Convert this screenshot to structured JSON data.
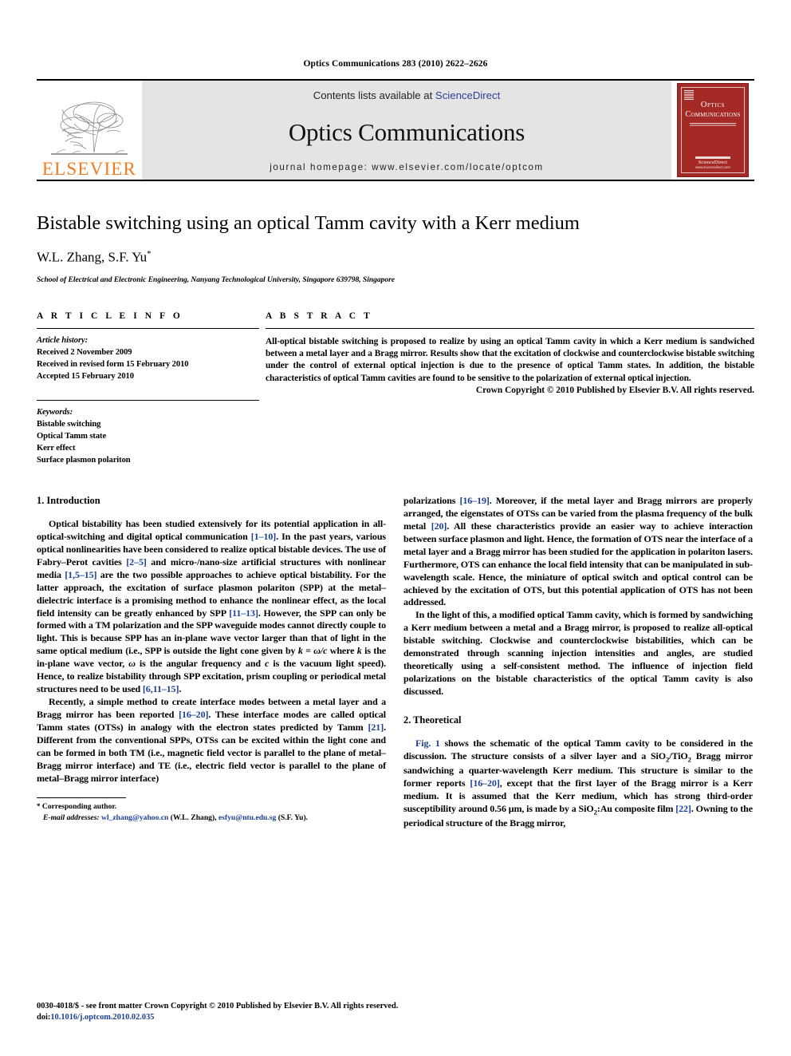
{
  "running_head": "Optics Communications 283 (2010) 2622–2626",
  "journal_header": {
    "publisher_logo_text": "ELSEVIER",
    "contents_prefix": "Contents lists available at",
    "contents_link": "ScienceDirect",
    "journal_title": "Optics Communications",
    "homepage_line": "journal homepage: www.elsevier.com/locate/optcom",
    "cover": {
      "line1": "Optics",
      "line2": "Communications",
      "footer_brand": "ScienceDirect",
      "footer_url": "www.sciencedirect.com"
    },
    "colors": {
      "banner_bg": "#e4e4e4",
      "link_blue": "#2b3f97",
      "elsevier_orange": "#ef7c20",
      "cover_red": "#a52a26"
    }
  },
  "article": {
    "title": "Bistable switching using an optical Tamm cavity with a Kerr medium",
    "authors": "W.L. Zhang, S.F. Yu",
    "corresponding_marker": "*",
    "affiliation": "School of Electrical and Electronic Engineering, Nanyang Technological University, Singapore 639798, Singapore"
  },
  "article_info": {
    "heading": "A R T I C L E    I N F O",
    "history_label": "Article history:",
    "history": [
      "Received 2 November 2009",
      "Received in revised form 15 February 2010",
      "Accepted 15 February 2010"
    ],
    "keywords_label": "Keywords:",
    "keywords": [
      "Bistable switching",
      "Optical Tamm state",
      "Kerr effect",
      "Surface plasmon polariton"
    ]
  },
  "abstract": {
    "heading": "A B S T R A C T",
    "text": "All-optical bistable switching is proposed to realize by using an optical Tamm cavity in which a Kerr medium is sandwiched between a metal layer and a Bragg mirror. Results show that the excitation of clockwise and counterclockwise bistable switching under the control of external optical injection is due to the presence of optical Tamm states. In addition, the bistable characteristics of optical Tamm cavities are found to be sensitive to the polarization of external optical injection.",
    "copyright": "Crown Copyright © 2010 Published by Elsevier B.V. All rights reserved."
  },
  "sections": {
    "introduction_heading": "1. Introduction",
    "theoretical_heading": "2. Theoretical"
  },
  "body": {
    "intro_p1": {
      "seg1": "Optical bistability has been studied extensively for its potential application in all-optical-switching and digital optical communication ",
      "ref1": "[1–10]",
      "seg2": ". In the past years, various optical nonlinearities have been considered to realize optical bistable devices. The use of Fabry–Perot cavities ",
      "ref2": "[2–5]",
      "seg3": " and micro-/nano-size artificial structures with nonlinear media ",
      "ref3": "[1,5–15]",
      "seg4": " are the two possible approaches to achieve optical bistability. For the latter approach, the excitation of surface plasmon polariton (SPP) at the metal–dielectric interface is a promising method to enhance the nonlinear effect, as the local field intensity can be greatly enhanced by SPP ",
      "ref4": "[11–13]",
      "seg5": ". However, the SPP can only be formed with a TM polarization and the SPP waveguide modes cannot directly couple to light. This is because SPP has an in-plane wave vector larger than that of light in the same optical medium (i.e., SPP is outside the light cone given by ",
      "math1": "k = ω/c",
      "seg6": " where ",
      "math2": "k",
      "seg7": " is the in-plane wave vector, ",
      "math3": "ω",
      "seg8": " is the angular frequency and ",
      "math4": "c",
      "seg9": " is the vacuum light speed). Hence, to realize bistability through SPP excitation, prism coupling or periodical metal structures need to be used ",
      "ref5": "[6,11–15]",
      "seg10": "."
    },
    "intro_p2": {
      "seg1": "Recently, a simple method to create interface modes between a metal layer and a Bragg mirror has been reported ",
      "ref1": "[16–20]",
      "seg2": ". These interface modes are called optical Tamm states (OTSs) in analogy with the electron states predicted by Tamm ",
      "ref2": "[21]",
      "seg3": ". Different from the conventional SPPs, OTSs can be excited within the light cone and can be formed in both TM (i.e., magnetic field vector is parallel to the plane of metal–Bragg mirror interface) and TE (i.e., electric field vector is parallel to the plane of metal–Bragg mirror interface)"
    },
    "right_p1": {
      "seg1": "polarizations ",
      "ref1": "[16–19]",
      "seg2": ". Moreover, if the metal layer and Bragg mirrors are properly arranged, the eigenstates of OTSs can be varied from the plasma frequency of the bulk metal ",
      "ref2": "[20]",
      "seg3": ". All these characteristics provide an easier way to achieve interaction between surface plasmon and light. Hence, the formation of OTS near the interface of a metal layer and a Bragg mirror has been studied for the application in polariton lasers. Furthermore, OTS can enhance the local field intensity that can be manipulated in sub-wavelength scale. Hence, the miniature of optical switch and optical control can be achieved by the excitation of OTS, but this potential application of OTS has not been addressed."
    },
    "right_p2": {
      "text": "In the light of this, a modified optical Tamm cavity, which is formed by sandwiching a Kerr medium between a metal and a Bragg mirror, is proposed to realize all-optical bistable switching. Clockwise and counterclockwise bistabilities, which can be demonstrated through scanning injection intensities and angles, are studied theoretically using a self-consistent method. The influence of injection field polarizations on the bistable characteristics of the optical Tamm cavity is also discussed."
    },
    "theor_p1": {
      "figref": "Fig. 1",
      "seg1": " shows the schematic of the optical Tamm cavity to be considered in the discussion. The structure consists of a silver layer and a SiO",
      "sub1": "2",
      "seg2": "/TiO",
      "sub2": "2",
      "seg3": " Bragg mirror sandwiching a quarter-wavelength Kerr medium. This structure is similar to the former reports ",
      "ref1": "[16–20]",
      "seg4": ", except that the first layer of the Bragg mirror is a Kerr medium. It is assumed that the Kerr medium, which has strong third-order susceptibility around 0.56 μm, is made by a SiO",
      "sub3": "2",
      "seg5": ":Au composite film ",
      "ref2": "[22]",
      "seg6": ". Owning to the periodical structure of the Bragg mirror,"
    }
  },
  "footnote": {
    "star": "*",
    "corresponding": " Corresponding author.",
    "email_label": "E-mail addresses:",
    "email1": "wl_zhang@yahoo.cn",
    "email1_name": " (W.L. Zhang), ",
    "email2": "esfyu@ntu.edu.sg",
    "email2_name": " (S.F. Yu)."
  },
  "page_footer": {
    "issn_line": "0030-4018/$ - see front matter Crown Copyright © 2010 Published by Elsevier B.V. All rights reserved.",
    "doi_label": "doi:",
    "doi_value": "10.1016/j.optcom.2010.02.035"
  }
}
